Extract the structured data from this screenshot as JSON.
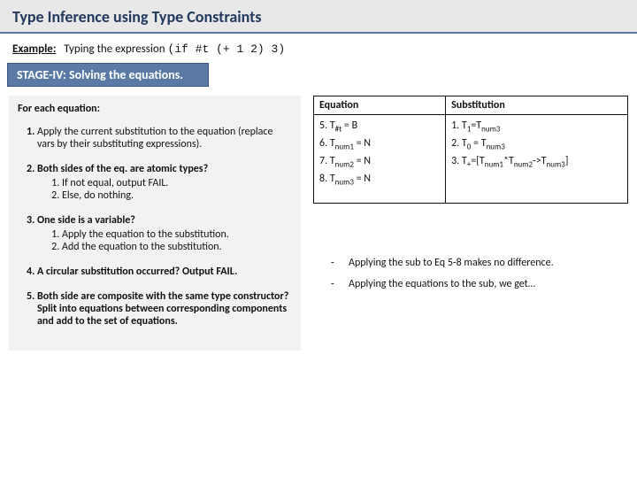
{
  "title": "Type Inference using Type Constraints",
  "example_label": "Example:",
  "example_text": "Typing the expression",
  "example_code": "(if #t  (+ 1 2)  3)",
  "stage": "STAGE-IV: Solving the equations.",
  "for_each": "For each equation:",
  "steps": {
    "s1": "Apply the current substitution to the equation (replace vars by their substituting expressions).",
    "s2": "Both sides of the eq. are atomic types?",
    "s2a": "If not equal, output FAIL.",
    "s2b": "Else, do nothing.",
    "s3": "One side is a variable?",
    "s3a": "Apply the equation to the substitution.",
    "s3b": "Add the equation to the substitution.",
    "s4": "A circular substitution occurred? Output FAIL.",
    "s5": "Both side are composite with the same type constructor? Split into equations between corresponding components and add to the set of equations."
  },
  "table": {
    "h1": "Equation",
    "h2": "Substitution",
    "eq5": "5. T#t = B",
    "eq6": "6. Tnum1 = N",
    "eq7": "7. Tnum2 = N",
    "eq8": "8. Tnum3 = N",
    "sub1": "1. T1=Tnum3",
    "sub2": "2. T0 = Tnum3",
    "sub3": "3. T+=[Tnum1*Tnum2->Tnum3]"
  },
  "notes": {
    "n1": "Applying the sub to Eq 5-8 makes no difference.",
    "n2": "Applying the equations to the sub, we get…"
  }
}
